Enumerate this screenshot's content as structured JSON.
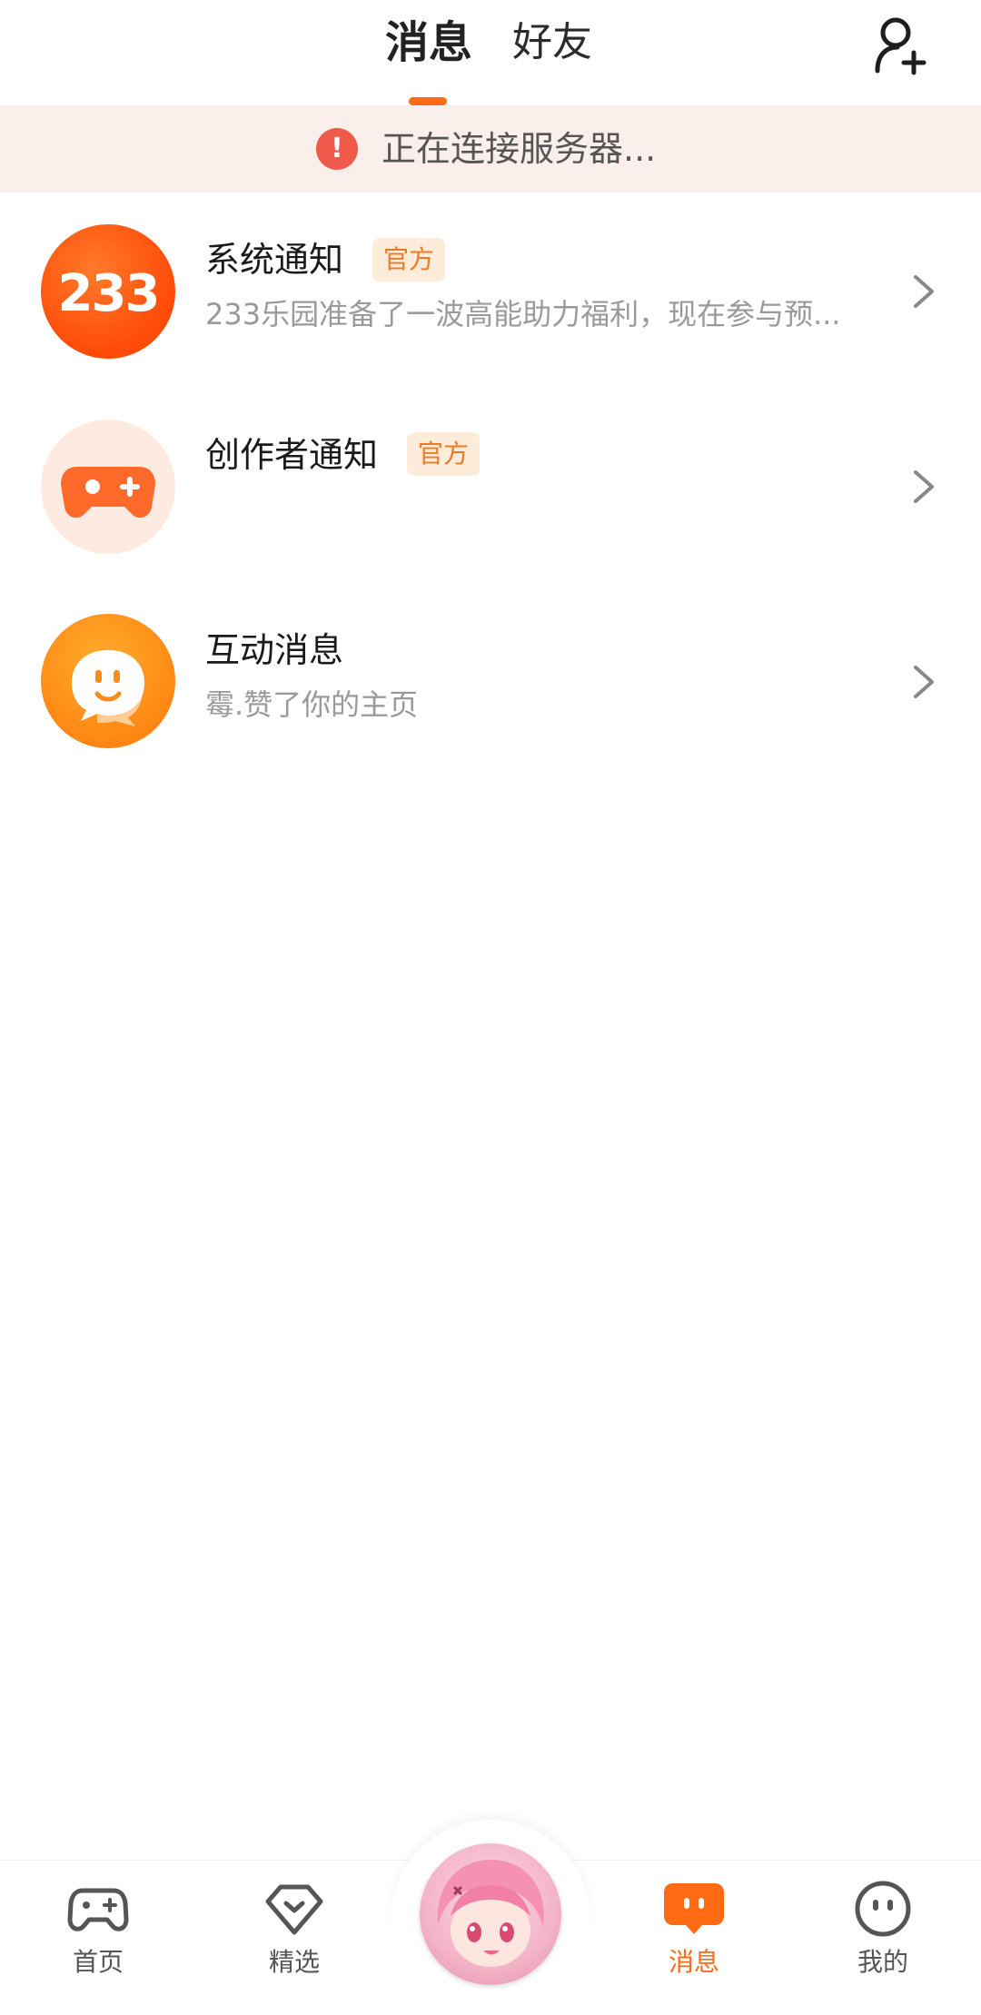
{
  "header": {
    "tab_active": "消息",
    "tab_inactive": "好友"
  },
  "banner": {
    "text": "正在连接服务器..."
  },
  "messages": [
    {
      "title": "系统通知",
      "badge": "官方",
      "desc": "233乐园准备了一波高能助力福利，现在参与预...",
      "avatar_text": "233"
    },
    {
      "title": "创作者通知",
      "badge": "官方",
      "desc": ""
    },
    {
      "title": "互动消息",
      "desc": "霉.赞了你的主页"
    }
  ],
  "nav": {
    "home": "首页",
    "featured": "精选",
    "messages": "消息",
    "mine": "我的"
  },
  "colors": {
    "accent": "#ff6a13",
    "banner_bg": "#fbefeb",
    "badge_bg": "#fdecd9",
    "badge_text": "#ee7a22"
  },
  "icons": [
    "add-friend-icon",
    "alert-icon",
    "gamepad-icon",
    "chat-bubble-icon",
    "chevron-right-icon",
    "heart-diamond-icon",
    "smile-face-icon"
  ]
}
